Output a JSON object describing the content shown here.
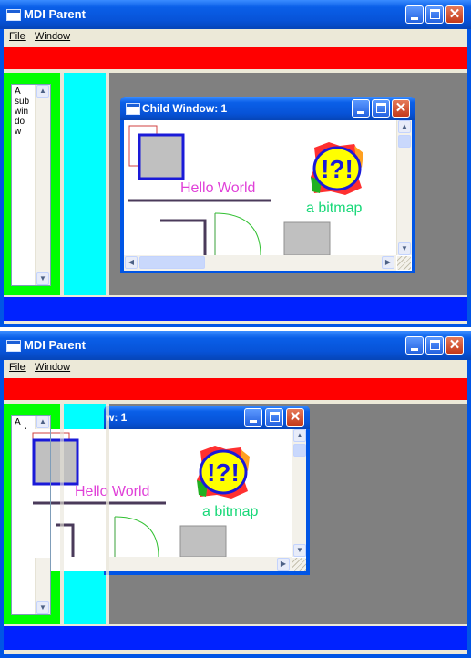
{
  "app": {
    "title": "MDI Parent"
  },
  "menu": {
    "file": "File",
    "window": "Window"
  },
  "child": {
    "title": "Child Window: 1",
    "title_partial": "w: 1",
    "hello": "Hello World",
    "bitmap_label": "a bitmap",
    "bitmap_glyph": "!?!"
  },
  "sidebar_list": {
    "text": "A\nsub\nwin\ndo\nw"
  },
  "captions": {
    "minimize": "_",
    "maximize": "□",
    "close": "✕"
  },
  "colors": {
    "top_bar": "#ff0000",
    "bottom_bar": "#0022ff",
    "left_panel": "#00ff00",
    "side_panel": "#00ffff",
    "mdi_background": "#808080"
  }
}
